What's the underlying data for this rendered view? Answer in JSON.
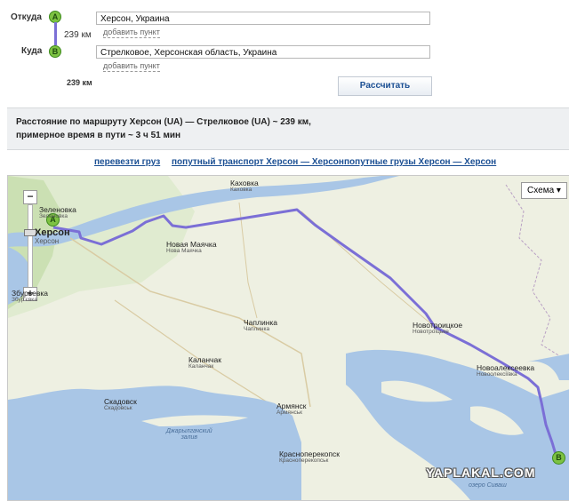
{
  "form": {
    "from_label": "Откуда",
    "to_label": "Куда",
    "marker_a": "A",
    "marker_b": "B",
    "leg_distance": "239 км",
    "from_value": "Херсон, Украина",
    "to_value": "Стрелковое, Херсонская область, Украина",
    "add_point": "добавить пункт",
    "total_distance": "239 км",
    "calc_button": "Рассчитать"
  },
  "summary": {
    "line1": "Расстояние по маршруту Херсон (UA) — Стрелковое (UA) ~ 239 км,",
    "line2": "примерное время в пути ~ 3 ч 51 мин"
  },
  "links": [
    "перевезти груз",
    "попутный транспорт Херсон — Херсон",
    "попутные грузы Херсон — Херсон"
  ],
  "map": {
    "type_button": "Схема ▾",
    "zoom_in": "−",
    "zoom_out": "+",
    "route_color": "#7b6fd6",
    "cities": [
      {
        "name": "Каховка",
        "sub": "Каховка"
      },
      {
        "name": "Зеленовка",
        "sub": "Зеленовка"
      },
      {
        "name": "Херсон",
        "sub": "Херсон"
      },
      {
        "name": "Новая Маячка",
        "sub": "Нова Маячка"
      },
      {
        "name": "Збурьевка",
        "sub": "Збур'євка"
      },
      {
        "name": "Чаплинка",
        "sub": "Чаплинка"
      },
      {
        "name": "Новотроицкое",
        "sub": "Новотроїцьке"
      },
      {
        "name": "Каланчак",
        "sub": "Каланчак"
      },
      {
        "name": "Новоалексеевка",
        "sub": "Новоолексіївка"
      },
      {
        "name": "Скадовск",
        "sub": "Скадовськ"
      },
      {
        "name": "Армянск",
        "sub": "Армянськ"
      },
      {
        "name": "Красноперекопск",
        "sub": "Красноперекопськ"
      }
    ],
    "gulf_label_1": "Джарылгачский",
    "gulf_label_2": "залив",
    "lake_label": "озеро Сиваш",
    "watermark": "YAPLAKAL.COM"
  }
}
